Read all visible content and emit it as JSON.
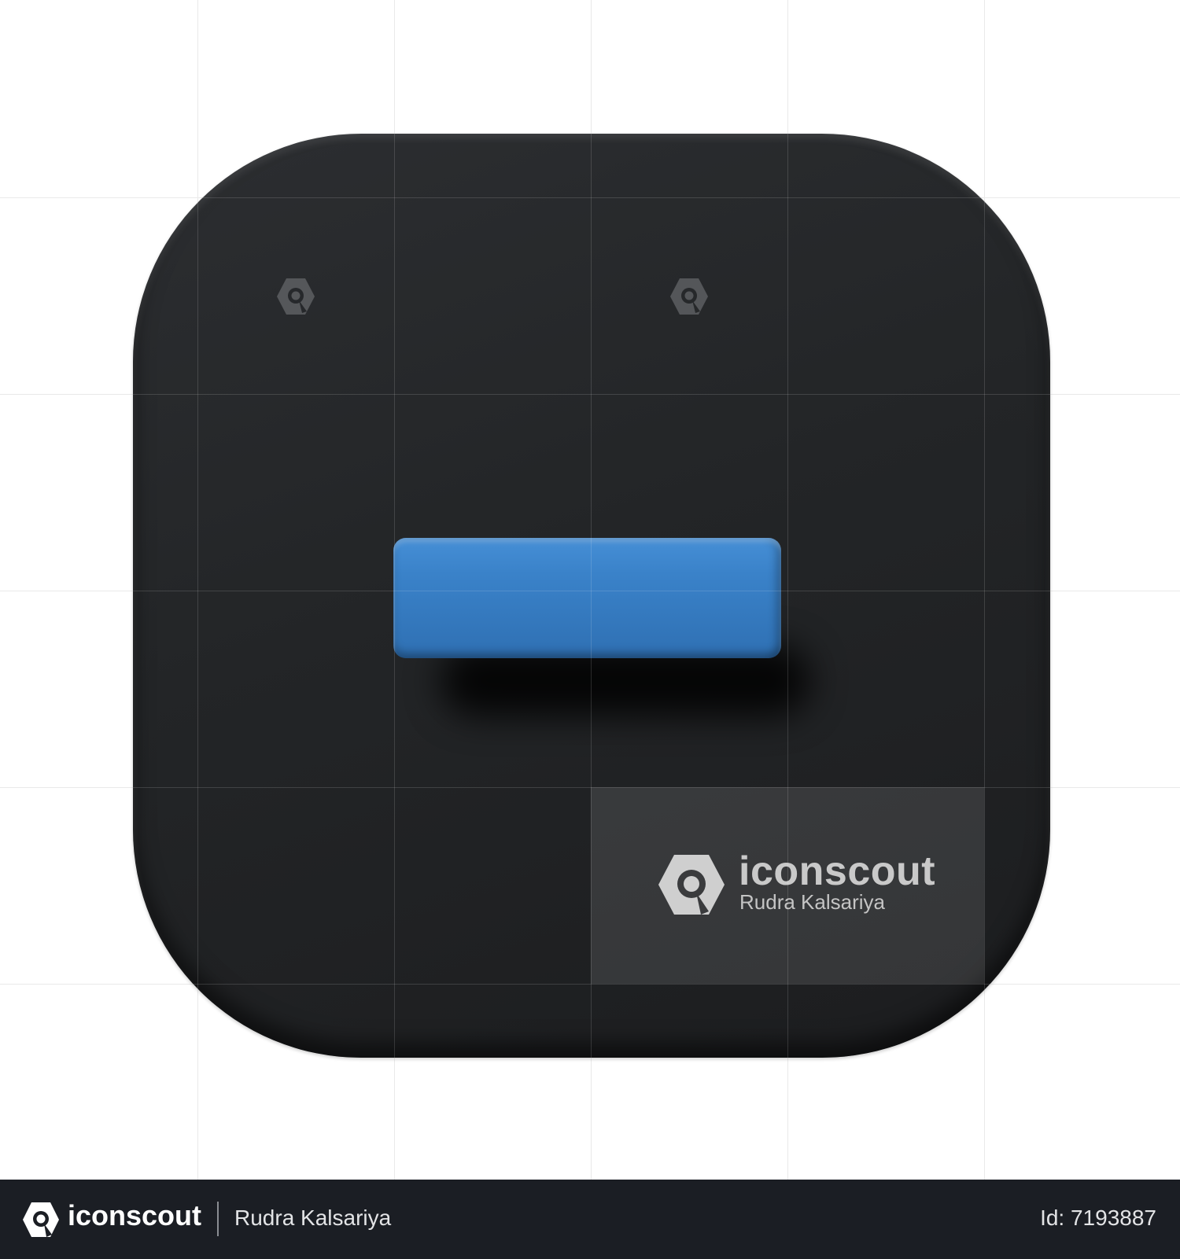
{
  "watermark": {
    "brand": "iconscout",
    "author": "Rudra Kalsariya"
  },
  "footer": {
    "brand": "iconscout",
    "author": "Rudra Kalsariya",
    "asset_id": "Id: 7193887"
  },
  "icon": {
    "depicts": "minus-sign",
    "tile_color": "#26282b",
    "bar_color": "#3a82c9"
  }
}
